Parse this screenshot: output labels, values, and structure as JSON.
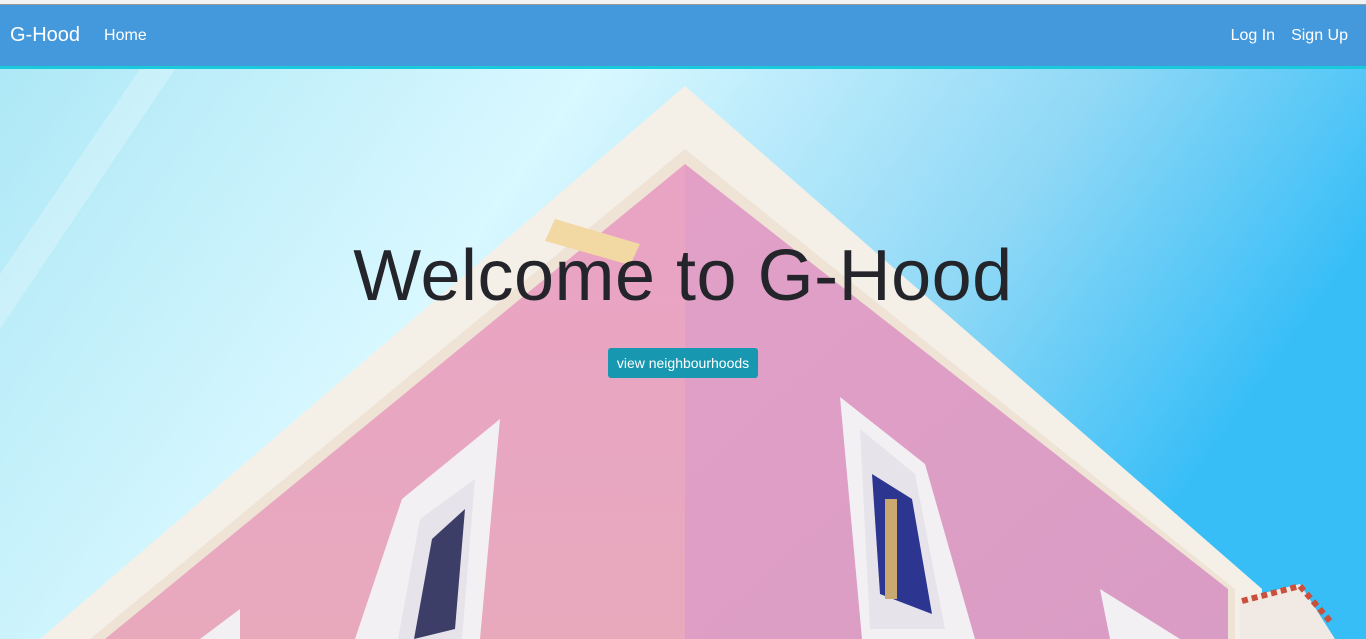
{
  "navbar": {
    "brand": "G-Hood",
    "links": [
      {
        "label": "Home"
      }
    ],
    "right_links": [
      {
        "label": "Log In"
      },
      {
        "label": "Sign Up"
      }
    ],
    "color": "#4499dc",
    "accent_color": "#19c9dc"
  },
  "hero": {
    "title": "Welcome to G-Hood",
    "button_label": "view neighbourhoods",
    "button_color": "#1797b0",
    "background": "pink building corner against blue sky"
  }
}
